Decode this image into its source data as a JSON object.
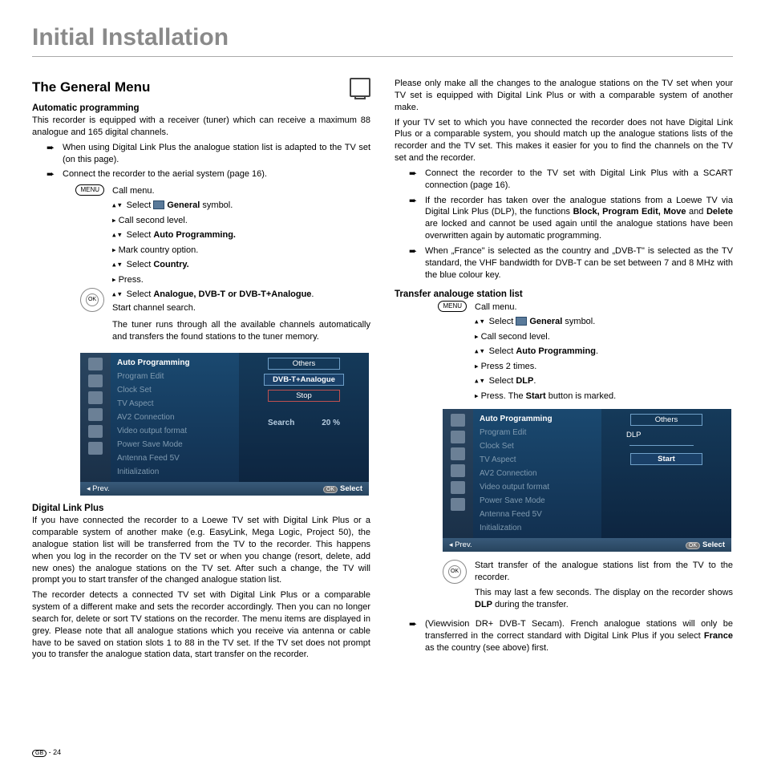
{
  "title": "Initial Installation",
  "left": {
    "heading": "The General Menu",
    "sub1": "Automatic programming",
    "intro": "This recorder is equipped with a receiver (tuner) which can receive a maximum 88 analogue and 165 digital channels.",
    "b1": "When using Digital Link Plus the analogue station list is adapted to the TV set (on this page).",
    "b2": "Connect the recorder to the aerial system (page 16).",
    "s_menu": "MENU",
    "s_callmenu": "Call menu.",
    "s_select": "Select",
    "s_general": "General",
    "s_symbol": "symbol.",
    "s_call2": "Call second level.",
    "s_autoprog": "Auto Programming.",
    "s_markcountry": "Mark country option.",
    "s_country": "Country.",
    "s_press": "Press.",
    "s_selectAD": "Analogue, DVB-T or DVB-T+Analogue",
    "s_start": "Start channel search.",
    "s_tuner": "The tuner runs through all the available channels automatically and transfers the found stations to the tuner memory.",
    "dlp_head": "Digital Link Plus",
    "dlp_p1": "If you have connected the recorder to a Loewe TV set with Digital Link Plus or a comparable system of another make (e.g. EasyLink, Mega Logic, Project 50), the analogue station list will be transferred from the TV to the recorder. This happens when you log in the recorder on the TV set or when you change (resort, delete, add new ones) the analogue stations on the TV set. After such a change, the TV will prompt you to start transfer of the changed analogue station list.",
    "dlp_p2": "The recorder detects a connected TV set with Digital Link Plus or a comparable system of a different make and sets the recorder accordingly. Then you can no longer search for, delete or sort TV stations on the recorder. The menu items are displayed in grey. Please note that all analogue stations which you receive via antenna or cable have to be saved on station slots 1 to 88 in the TV set. If the TV set does not prompt you to transfer the analogue station data, start transfer on the recorder."
  },
  "right": {
    "p1": "Please only make all the changes to the analogue stations on the TV set when your TV set is equipped with Digital Link Plus or with a comparable system of another make.",
    "p2": "If your TV set to which you have connected the recorder does not have Digital Link Plus or a comparable system, you should match up the analogue stations lists of the recorder and the TV set. This makes it easier for you to find the channels on the TV set and the recorder.",
    "b1": "Connect the recorder to the TV set with Digital Link Plus with a SCART connection (page 16).",
    "b2a": "If the recorder has taken over the analogue stations from a Loewe TV via Digital Link Plus (DLP), the functions ",
    "b2b": "Block, Program Edit, Move",
    "b2c": " and ",
    "b2d": "Delete",
    "b2e": " are locked and cannot be used again until the analogue stations have been overwritten again by automatic programming.",
    "b3": "When „France\" is selected as the country and „DVB-T\" is selected as the TV standard, the VHF bandwidth for DVB-T can be set between 7 and 8 MHz with the blue colour key.",
    "sub2": "Transfer analouge station list",
    "s_callmenu": "Call menu.",
    "s_select": "Select",
    "s_general": "General",
    "s_symbol": "symbol.",
    "s_call2": "Call second level.",
    "s_autoprog": "Auto Programming",
    "s_press2": "Press 2 times.",
    "s_dlp": "DLP",
    "s_pressstart": "Press. The ",
    "s_start": "Start",
    "s_marked": " button is marked.",
    "after1": "Start transfer of the analogue stations list from the TV to the recorder.",
    "after2a": "This may last a few seconds. The display on the recorder shows ",
    "after2b": "DLP",
    "after2c": " during the transfer.",
    "b4a": "(Viewvision DR+ DVB-T Secam). French analogue stations will only be transferred in the correct standard with Digital Link Plus if you select ",
    "b4b": "France",
    "b4c": " as the country (see above) first."
  },
  "osd": {
    "menu": [
      "Auto Programming",
      "Program Edit",
      "Clock Set",
      "TV Aspect",
      "AV2 Connection",
      "Video output format",
      "Power Save Mode",
      "Antenna Feed 5V",
      "Initialization"
    ],
    "others": "Others",
    "dvbt": "DVB-T+Analogue",
    "stop": "Stop",
    "search": "Search",
    "pct": "20 %",
    "dlp": "DLP",
    "start": "Start",
    "prev": "Prev.",
    "select": "Select",
    "ok": "OK"
  },
  "footer": {
    "gb": "GB",
    "page": " - 24"
  }
}
